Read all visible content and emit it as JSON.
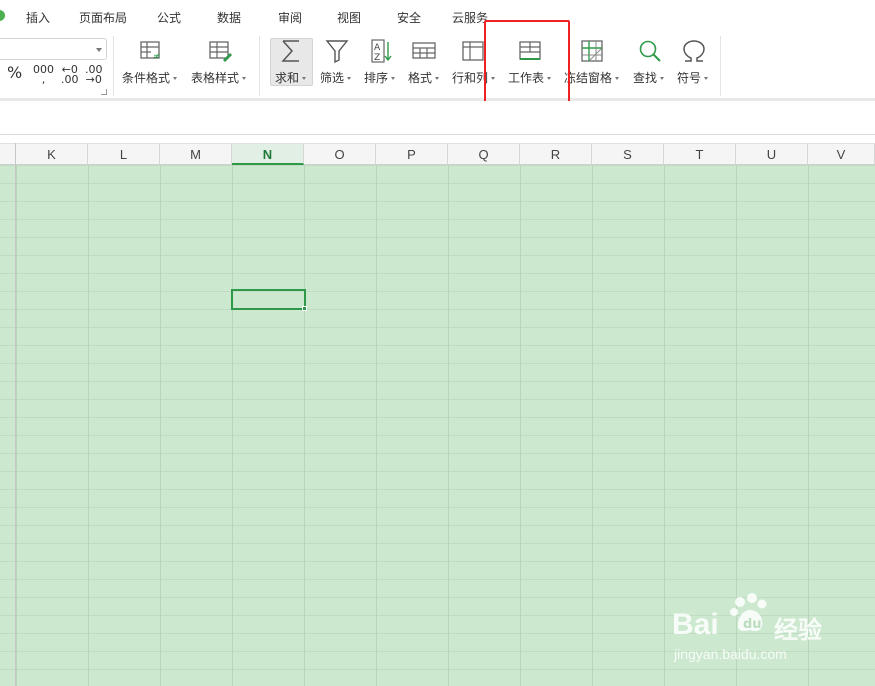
{
  "menu": {
    "items": [
      "插入",
      "页面布局",
      "公式",
      "数据",
      "审阅",
      "视图",
      "安全",
      "云服务"
    ]
  },
  "ribbon": {
    "number_format": {
      "percent": "%",
      "thousands": "000",
      "thousands_sub": ",",
      "increase_decimal": "←0",
      "increase_decimal_sub": ".00",
      "decrease_decimal": ".00",
      "decrease_decimal_sub": "→0"
    },
    "tools": [
      {
        "label": "条件格式",
        "icon": "conditional-format-icon"
      },
      {
        "label": "表格样式",
        "icon": "table-style-icon"
      },
      {
        "label": "求和",
        "icon": "sigma-icon"
      },
      {
        "label": "筛选",
        "icon": "filter-icon"
      },
      {
        "label": "排序",
        "icon": "sort-az-icon"
      },
      {
        "label": "格式",
        "icon": "format-icon"
      },
      {
        "label": "行和列",
        "icon": "rows-columns-icon"
      },
      {
        "label": "工作表",
        "icon": "worksheet-icon"
      },
      {
        "label": "冻结窗格",
        "icon": "freeze-panes-icon"
      },
      {
        "label": "查找",
        "icon": "search-icon"
      },
      {
        "label": "符号",
        "icon": "omega-icon"
      }
    ]
  },
  "sheet": {
    "columns": [
      "K",
      "L",
      "M",
      "N",
      "O",
      "P",
      "Q",
      "R",
      "S",
      "T",
      "U",
      "V"
    ],
    "active_column": "N"
  },
  "colors": {
    "grid_background": "#cce8cf",
    "accent": "#2e9a49",
    "highlight": "#e22222"
  },
  "watermark": {
    "brand": "Bai",
    "brand2": "经验",
    "url": "jingyan.baidu.com"
  }
}
